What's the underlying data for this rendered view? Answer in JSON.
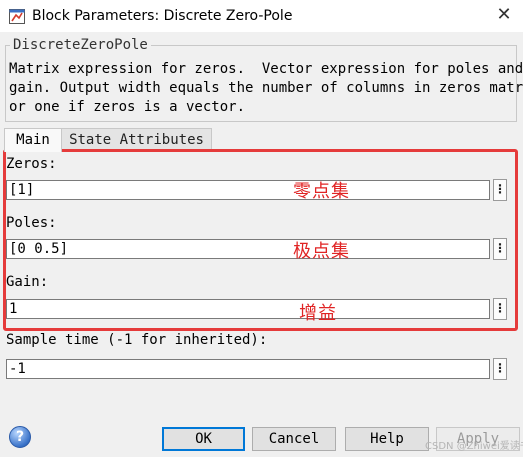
{
  "window": {
    "title": "Block Parameters: Discrete Zero-Pole",
    "close_glyph": "✕"
  },
  "group": {
    "legend": "DiscreteZeroPole",
    "description_lines": [
      "Matrix expression for zeros.  Vector expression for poles and",
      "gain. Output width equals the number of columns in zeros matrix,",
      "or one if zeros is a vector."
    ]
  },
  "tabs": [
    {
      "label": "Main",
      "selected": true
    },
    {
      "label": "State Attributes",
      "selected": false
    }
  ],
  "fields": {
    "zeros": {
      "label": "Zeros:",
      "value": "[1]",
      "annotation": "零点集"
    },
    "poles": {
      "label": "Poles:",
      "value": "[0 0.5]",
      "annotation": "极点集"
    },
    "gain": {
      "label": "Gain:",
      "value": "1",
      "annotation": "增益"
    },
    "sample_time": {
      "label": "Sample time (-1 for inherited):",
      "value": "-1"
    }
  },
  "field_menu_glyph": "⋮",
  "help_glyph": "?",
  "buttons": {
    "ok": "OK",
    "cancel": "Cancel",
    "help": "Help",
    "apply": "Apply"
  },
  "watermark": "CSDN @Zhiwei爱读书",
  "colors": {
    "annotation_red": "#e53b3b",
    "default_button_border": "#0078d7",
    "dialog_background": "#f0f0f0"
  }
}
